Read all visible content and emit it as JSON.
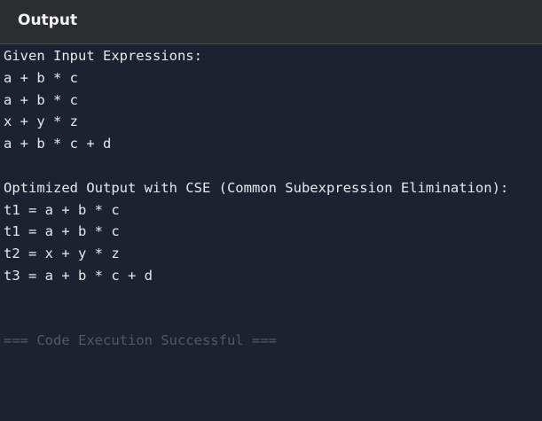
{
  "header": {
    "title": "Output"
  },
  "output": {
    "input_heading": "Given Input Expressions:",
    "input_lines": [
      "a + b * c",
      "a + b * c",
      "x + y * z",
      "a + b * c + d"
    ],
    "optimized_heading": "Optimized Output with CSE (Common Subexpression Elimination):",
    "optimized_lines": [
      "t1 = a + b * c",
      "t1 = a + b * c",
      "t2 = x + y * z",
      "t3 = a + b * c + d"
    ],
    "status": "=== Code Execution Successful ==="
  },
  "colors": {
    "page_background": "#1e2230",
    "header_background": "#2b2d31",
    "text": "#e6e8ec",
    "status_text": "#535865"
  }
}
